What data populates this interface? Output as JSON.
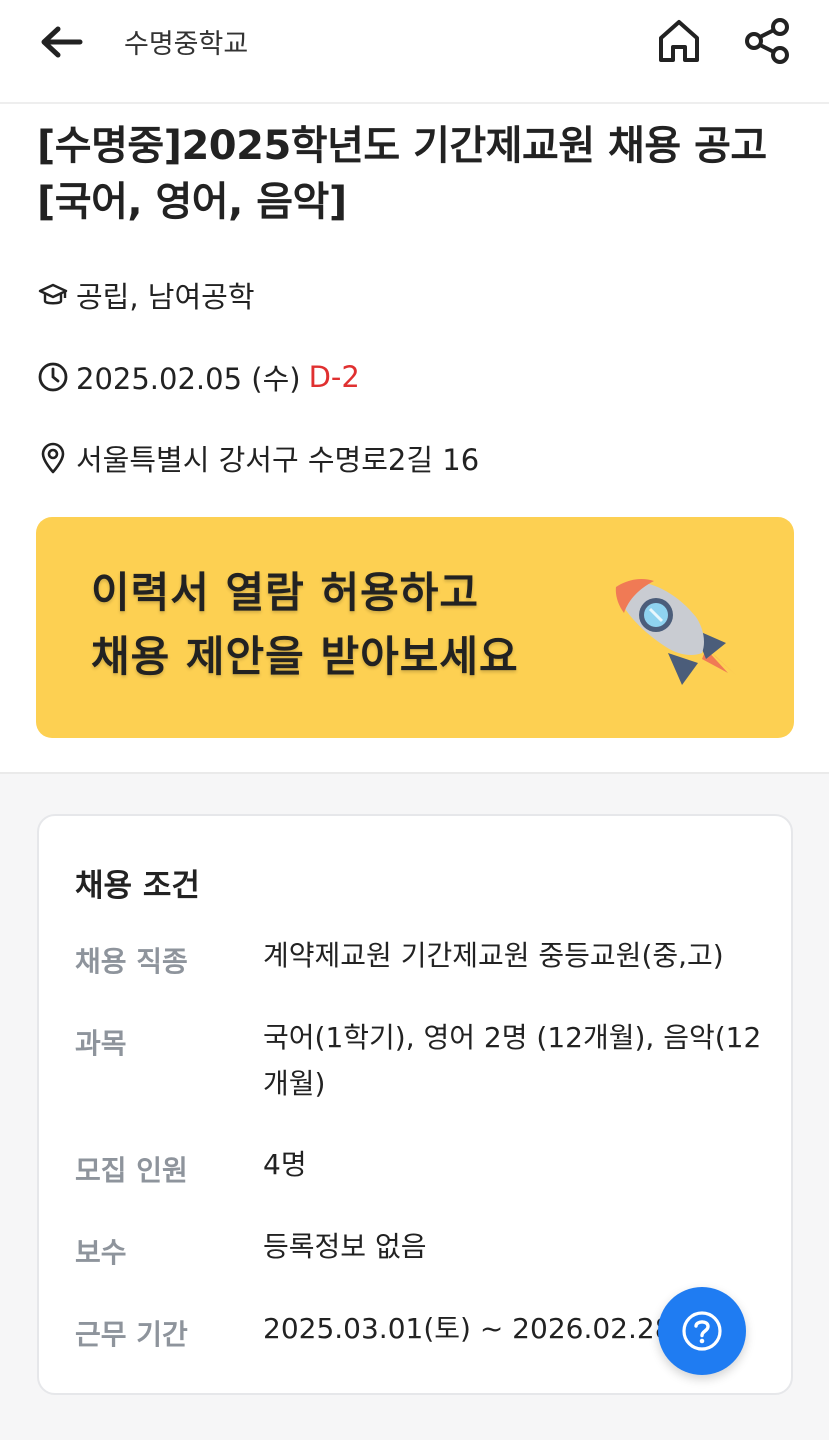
{
  "header": {
    "title": "수명중학교"
  },
  "post": {
    "title_line1": "[수명중]2025학년도 기간제교원 채용 공고",
    "title_line2": "[국어, 영어, 음악]",
    "school_type": "공립, 남여공학",
    "deadline": "2025.02.05 (수)",
    "dday": "D-2",
    "address": "서울특별시 강서구 수명로2길 16"
  },
  "banner": {
    "line1": "이력서 열람 허용하고",
    "line2": "채용 제안을 받아보세요"
  },
  "conditions": {
    "title": "채용 조건",
    "rows": [
      {
        "label": "채용 직종",
        "value": "계약제교원 기간제교원  중등교원(중,고)"
      },
      {
        "label": "과목",
        "value": "국어(1학기), 영어 2명 (12개월), 음악(12개월)"
      },
      {
        "label": "모집 인원",
        "value": "4명"
      },
      {
        "label": "보수",
        "value": "등록정보 없음"
      },
      {
        "label": "근무 기간",
        "value": "2025.03.01(토) ~ 2026.02.28"
      }
    ]
  },
  "icons": {
    "back": "arrow-left-icon",
    "home": "home-icon",
    "share": "share-icon",
    "school": "graduation-cap-icon",
    "clock": "clock-icon",
    "location": "map-pin-icon",
    "rocket": "rocket-icon",
    "help": "question-icon"
  },
  "colors": {
    "accent": "#1f7cf2",
    "banner": "#fdd052",
    "dday": "#e03030"
  }
}
